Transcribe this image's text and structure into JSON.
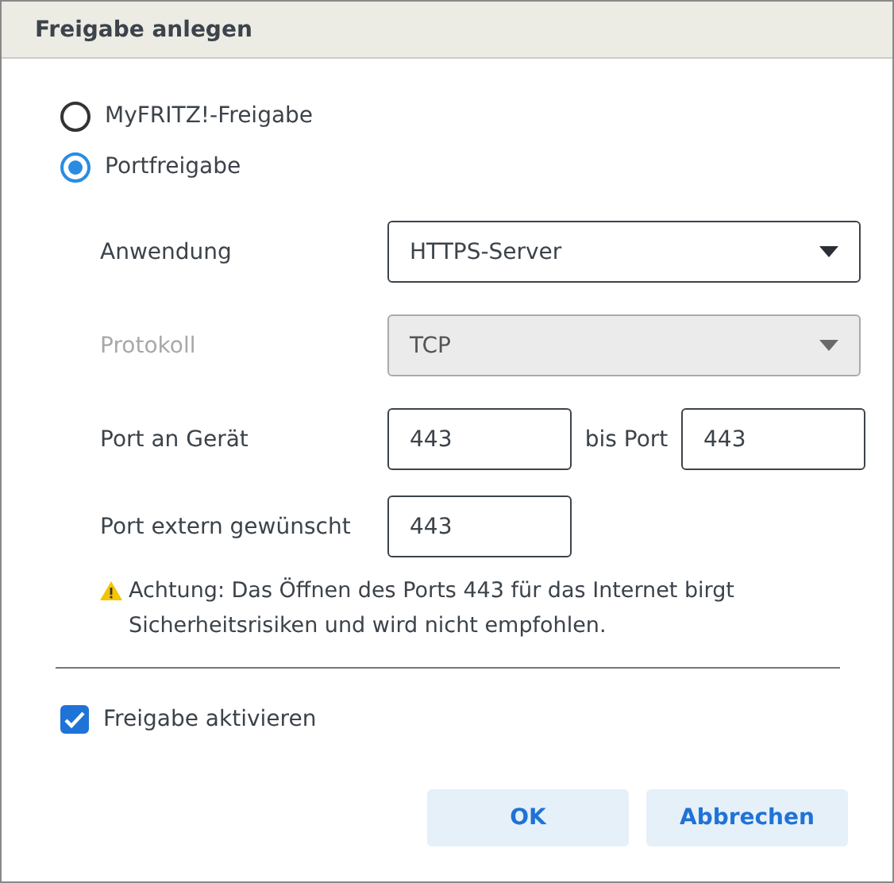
{
  "dialog": {
    "title": "Freigabe anlegen"
  },
  "share_types": [
    {
      "label": "MyFRITZ!-Freigabe",
      "selected": false
    },
    {
      "label": "Portfreigabe",
      "selected": true
    }
  ],
  "fields": [
    {
      "kind": "select",
      "label": "Anwendung",
      "value": "HTTPS-Server",
      "disabled": false
    },
    {
      "kind": "select",
      "label": "Protokoll",
      "value": "TCP",
      "disabled": true
    },
    {
      "kind": "range",
      "label": "Port an Gerät",
      "value": "443",
      "separator": "bis Port",
      "value_to": "443",
      "disabled": false
    },
    {
      "kind": "input",
      "label": "Port extern gewünscht",
      "value": "443",
      "disabled": false
    }
  ],
  "warning": "Achtung: Das Öffnen des Ports 443 für das Internet birgt Sicherheitsrisiken und wird nicht empfohlen.",
  "activate": {
    "label": "Freigabe aktivieren",
    "checked": true
  },
  "buttons": [
    "OK",
    "Abbrechen"
  ]
}
